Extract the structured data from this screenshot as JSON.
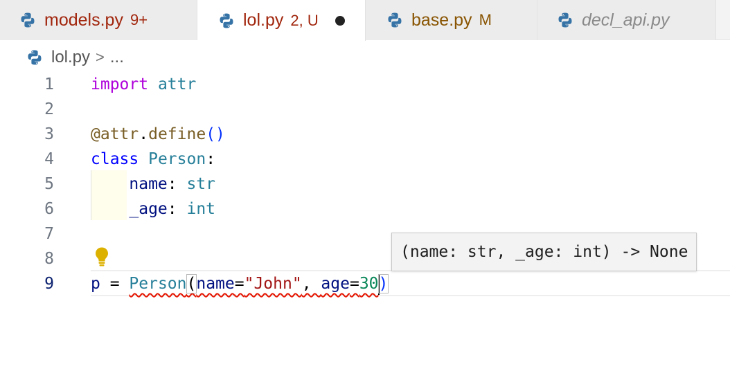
{
  "tabs": [
    {
      "name": "models.py",
      "badge": "9+"
    },
    {
      "name": "lol.py",
      "badge": "2, U"
    },
    {
      "name": "base.py",
      "badge": "M"
    },
    {
      "name": "decl_api.py",
      "badge": ""
    }
  ],
  "breadcrumb": {
    "file": "lol.py",
    "separator": ">",
    "more": "..."
  },
  "editor": {
    "line_numbers": [
      "1",
      "2",
      "3",
      "4",
      "5",
      "6",
      "7",
      "8",
      "9"
    ],
    "l1": {
      "kw": "import",
      "mod": " attr"
    },
    "l3": {
      "at": "@attr",
      "dot": ".",
      "fn": "define",
      "parens": "()"
    },
    "l4": {
      "kw": "class",
      "cls": " Person",
      "colon": ":"
    },
    "l5": {
      "indent": "    ",
      "name": "name",
      "colon": ": ",
      "type": "str"
    },
    "l6": {
      "indent": "    ",
      "name": "_age",
      "colon": ": ",
      "type": "int"
    },
    "l9": {
      "var": "p",
      "eq": " = ",
      "cls": "Person",
      "open": "(",
      "arg1": "name",
      "eq2": "=",
      "s1": "\"John\"",
      "comma": ", ",
      "arg2": "age",
      "eq3": "=",
      "n1": "30",
      "close": ")"
    },
    "hint": "(name: str, _age: int) -> None",
    "icons": {
      "file": "python-icon",
      "bulb": "lightbulb-icon"
    },
    "colors": {
      "keyword": "#af00db",
      "class": "#267f99",
      "string": "#a31515",
      "number": "#098658",
      "error": "#e51400"
    }
  }
}
